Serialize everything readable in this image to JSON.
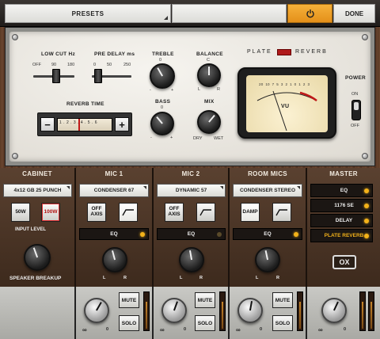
{
  "topbar": {
    "presets_label": "PRESETS",
    "done_label": "DONE",
    "accent": "#f0a028"
  },
  "reverb": {
    "title_left": "PLATE",
    "title_right": "REVERB",
    "low_cut": {
      "label": "LOW CUT Hz",
      "ticks": [
        "OFF",
        "90",
        "180"
      ]
    },
    "pre_delay": {
      "label": "PRE DELAY ms",
      "ticks": [
        "0",
        "50",
        "250"
      ]
    },
    "treble": {
      "label": "TREBLE",
      "top": "0",
      "min": "-",
      "max": "+"
    },
    "balance": {
      "label": "BALANCE",
      "top": "C",
      "min": "L",
      "max": "R"
    },
    "bass": {
      "label": "BASS",
      "top": "0",
      "min": "-",
      "max": "+"
    },
    "mix": {
      "label": "MIX",
      "min": "DRY",
      "max": "WET"
    },
    "reverb_time": {
      "label": "REVERB TIME",
      "minus": "−",
      "plus": "+",
      "scale": "1 . 2 . 3 . 4 . 5 . 6"
    },
    "meter": {
      "label": "VU",
      "scale": [
        "20",
        "10",
        "7",
        "5",
        "3",
        "2",
        "1",
        "0",
        "1",
        "2",
        "3"
      ]
    },
    "power": {
      "label": "POWER",
      "on": "ON",
      "off": "OFF"
    }
  },
  "cabinet": {
    "header": "CABINET",
    "model": "4x12 GB 25 PUNCH",
    "btn_50w": "50W",
    "btn_100w": "100W",
    "input_level": "INPUT LEVEL",
    "speaker_breakup": "SPEAKER BREAKUP"
  },
  "mic1": {
    "header": "MIC 1",
    "model": "CONDENSER 67",
    "off_axis": "OFF AXIS",
    "eq": "EQ",
    "l": "L",
    "r": "R",
    "eq_on": true
  },
  "mic2": {
    "header": "MIC 2",
    "model": "DYNAMIC 57",
    "off_axis": "OFF AXIS",
    "eq": "EQ",
    "l": "L",
    "r": "R",
    "eq_on": false
  },
  "room": {
    "header": "ROOM MICS",
    "model": "CONDENSER STEREO",
    "damp": "DAMP",
    "eq": "EQ",
    "l": "L",
    "r": "R",
    "eq_on": true
  },
  "master": {
    "header": "MASTER",
    "items": [
      "EQ",
      "1176 SE",
      "DELAY",
      "PLATE REVERB"
    ],
    "ox_label": "OX"
  },
  "bottom": {
    "mute": "MUTE",
    "solo": "SOLO",
    "inf": "∞",
    "zero": "0"
  }
}
